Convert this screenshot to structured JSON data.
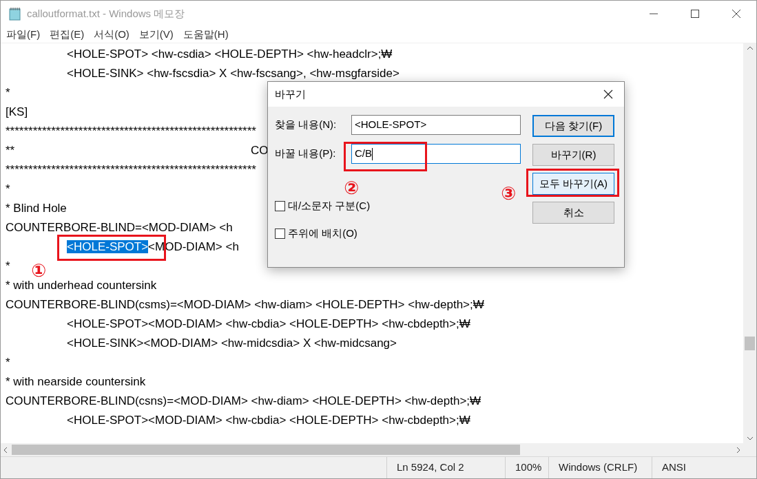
{
  "window": {
    "title": "calloutformat.txt - Windows 메모장"
  },
  "menu": [
    "파일(F)",
    "편집(E)",
    "서식(O)",
    "보기(V)",
    "도움말(H)"
  ],
  "editor": {
    "lines": [
      {
        "indented": true,
        "segments": [
          {
            "text": "<HOLE-SPOT> <hw-csdia> <HOLE-DEPTH> <hw-headclr>;₩",
            "selected": false
          }
        ]
      },
      {
        "indented": true,
        "segments": [
          {
            "text": "<HOLE-SINK> <hw-fscsdia> X <hw-fscsang>, <hw-msgfarside>",
            "selected": false
          }
        ]
      },
      {
        "indented": false,
        "segments": [
          {
            "text": "*",
            "selected": false
          }
        ]
      },
      {
        "indented": false,
        "segments": [
          {
            "text": "[KS]",
            "selected": false
          }
        ]
      },
      {
        "indented": false,
        "segments": [
          {
            "text": "*******************************************************",
            "selected": false
          }
        ]
      },
      {
        "indented": false,
        "segments": [
          {
            "text": "**\t\t\t\tCO",
            "selected": false
          }
        ]
      },
      {
        "indented": false,
        "segments": [
          {
            "text": "*******************************************************",
            "selected": false
          }
        ]
      },
      {
        "indented": false,
        "segments": [
          {
            "text": "*",
            "selected": false
          }
        ]
      },
      {
        "indented": false,
        "segments": [
          {
            "text": "* Blind Hole",
            "selected": false
          }
        ]
      },
      {
        "indented": false,
        "segments": [
          {
            "text": "COUNTERBORE-BLIND=<MOD-DIAM> <h",
            "selected": false
          }
        ]
      },
      {
        "indented": true,
        "segments": [
          {
            "text": "<HOLE-SPOT>",
            "selected": true
          },
          {
            "text": "<MOD-DIAM> <h",
            "selected": false
          }
        ]
      },
      {
        "indented": false,
        "segments": [
          {
            "text": "*",
            "selected": false
          }
        ]
      },
      {
        "indented": false,
        "segments": [
          {
            "text": "* with underhead countersink",
            "selected": false
          }
        ]
      },
      {
        "indented": false,
        "segments": [
          {
            "text": "COUNTERBORE-BLIND(csms)=<MOD-DIAM> <hw-diam> <HOLE-DEPTH> <hw-depth>;₩",
            "selected": false
          }
        ]
      },
      {
        "indented": true,
        "segments": [
          {
            "text": "<HOLE-SPOT><MOD-DIAM> <hw-cbdia> <HOLE-DEPTH> <hw-cbdepth>;₩",
            "selected": false
          }
        ]
      },
      {
        "indented": true,
        "segments": [
          {
            "text": "<HOLE-SINK><MOD-DIAM> <hw-midcsdia> X <hw-midcsang>",
            "selected": false
          }
        ]
      },
      {
        "indented": false,
        "segments": [
          {
            "text": "*",
            "selected": false
          }
        ]
      },
      {
        "indented": false,
        "segments": [
          {
            "text": "* with nearside countersink",
            "selected": false
          }
        ]
      },
      {
        "indented": false,
        "segments": [
          {
            "text": "COUNTERBORE-BLIND(csns)=<MOD-DIAM> <hw-diam> <HOLE-DEPTH> <hw-depth>;₩",
            "selected": false
          }
        ]
      },
      {
        "indented": true,
        "segments": [
          {
            "text": "<HOLE-SPOT><MOD-DIAM> <hw-cbdia> <HOLE-DEPTH> <hw-cbdepth>;₩",
            "selected": false
          }
        ]
      }
    ]
  },
  "dialog": {
    "title": "바꾸기",
    "fields": [
      {
        "label": "찾을 내용(N):",
        "value": "<HOLE-SPOT>",
        "focused": false
      },
      {
        "label": "바꿀 내용(P):",
        "value": "C/B",
        "focused": true
      }
    ],
    "buttons": [
      {
        "label": "다음 찾기(F)",
        "kind": "default"
      },
      {
        "label": "바꾸기(R)",
        "kind": "normal"
      },
      {
        "label": "모두 바꾸기(A)",
        "kind": "hover"
      },
      {
        "label": "취소",
        "kind": "normal"
      }
    ],
    "checkboxes": [
      {
        "label": "대/소문자 구분(C)",
        "checked": false
      },
      {
        "label": "주위에 배치(O)",
        "checked": false
      }
    ]
  },
  "annotations": [
    {
      "label": "①"
    },
    {
      "label": "②"
    },
    {
      "label": "③"
    }
  ],
  "status_bar": [
    "Ln 5924, Col 2",
    "100%",
    "Windows (CRLF)",
    "ANSI"
  ]
}
